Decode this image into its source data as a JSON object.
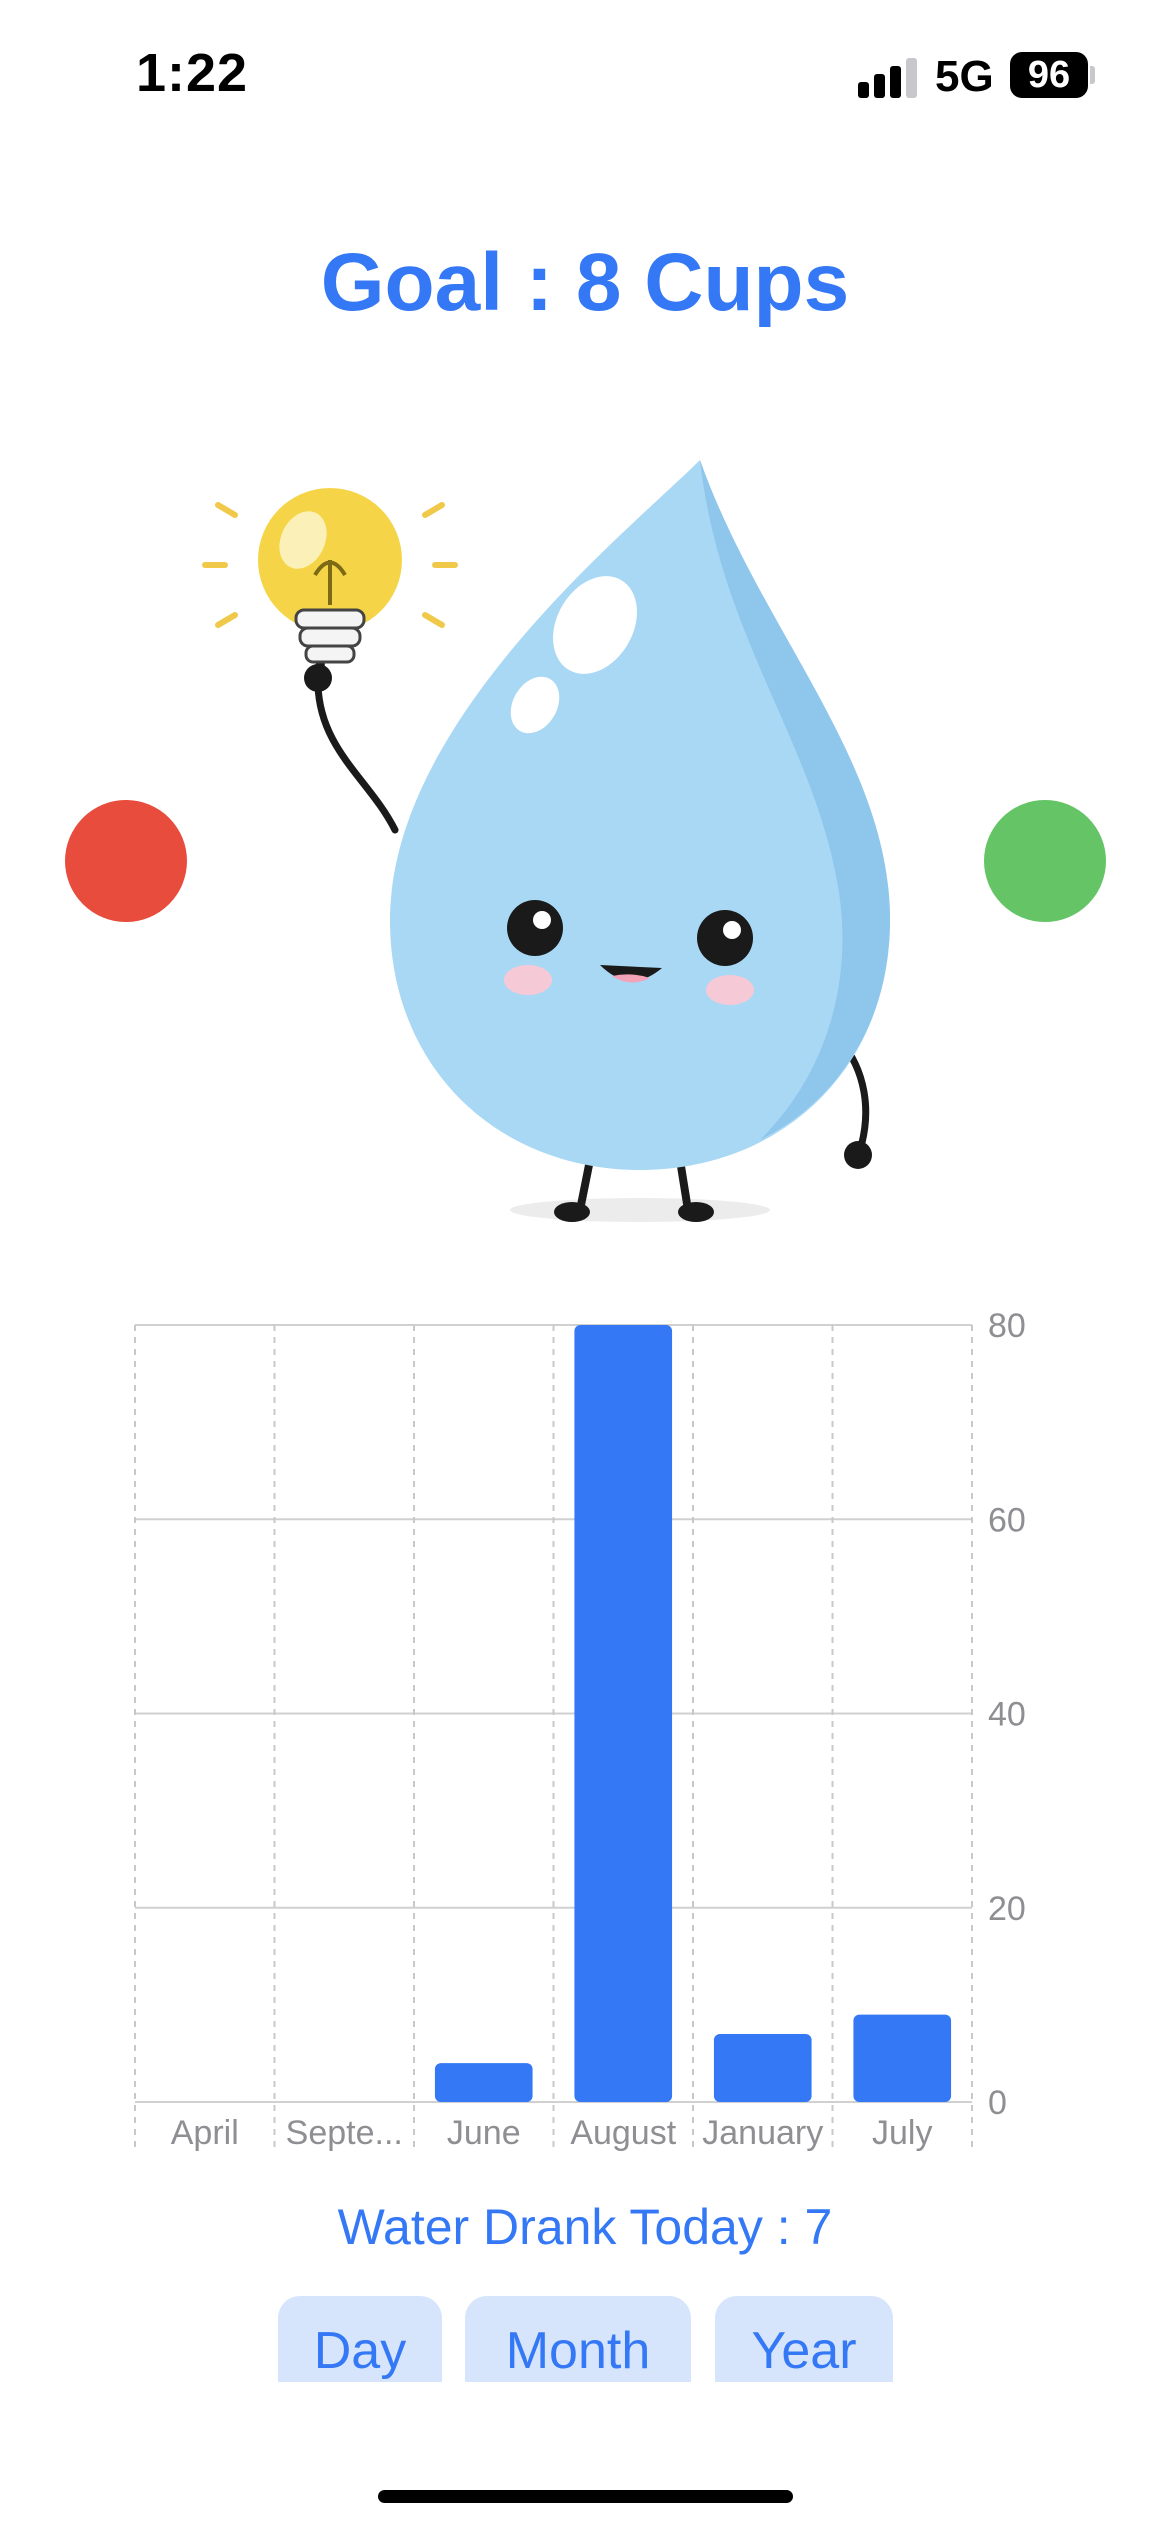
{
  "status_bar": {
    "time": "1:22",
    "network": "5G",
    "battery": "96"
  },
  "goal": {
    "title": "Goal : 8 Cups"
  },
  "illustration": {
    "description_icon": "water-drop-mascot-icon",
    "bulb_icon": "lightbulb-icon"
  },
  "buttons": {
    "decrease_color": "#e84c3d",
    "increase_color": "#64c466"
  },
  "chart_data": {
    "type": "bar",
    "categories": [
      "April",
      "Septe...",
      "June",
      "August",
      "January",
      "July"
    ],
    "values": [
      0,
      0,
      4,
      80,
      7,
      9
    ],
    "ylim": [
      0,
      80
    ],
    "yticks": [
      0,
      20,
      40,
      60,
      80
    ],
    "color": "#3478f6",
    "grid": true,
    "y_axis_side": "right"
  },
  "summary": {
    "drank_today": "Water Drank Today : 7"
  },
  "range": {
    "day": "Day",
    "month": "Month",
    "year": "Year"
  },
  "colors": {
    "accent": "#3478f6",
    "button_bg": "#d6e5fb"
  }
}
